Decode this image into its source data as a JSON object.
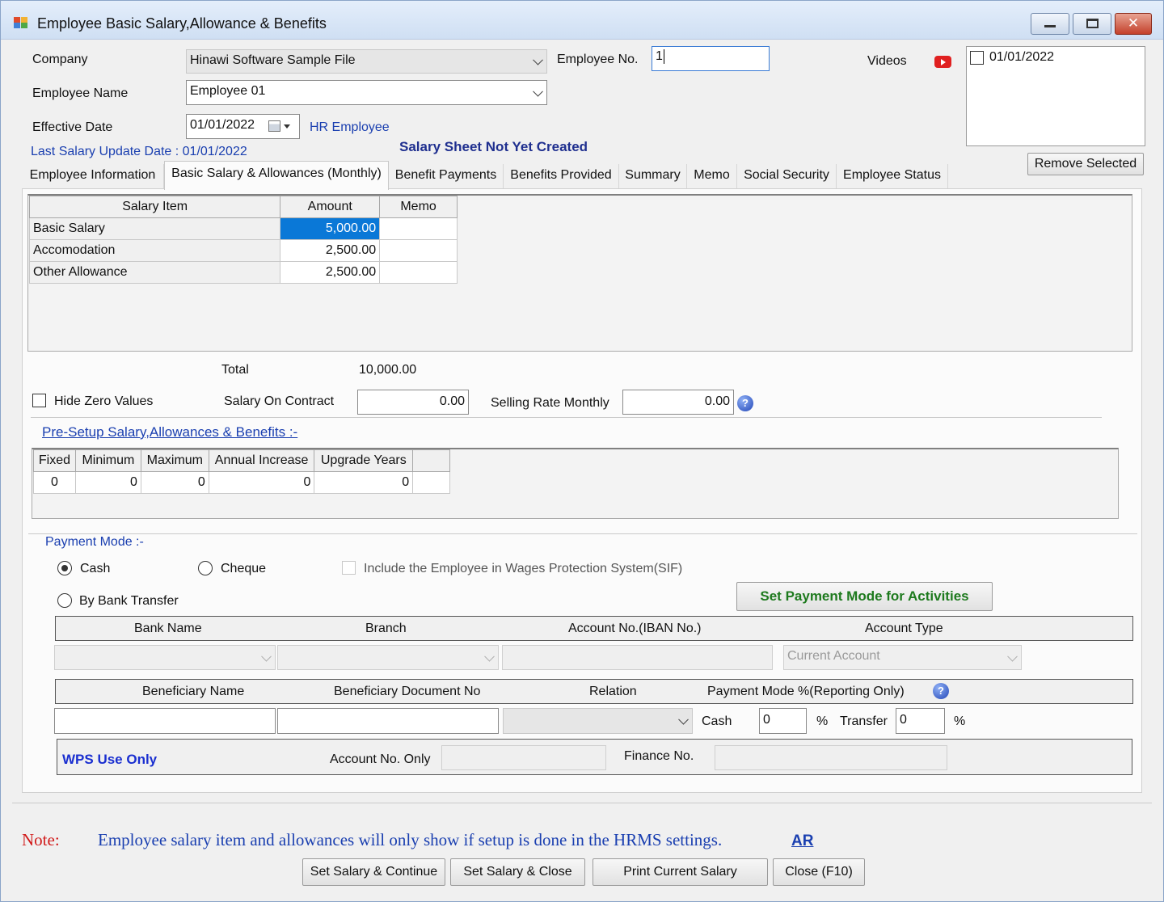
{
  "window": {
    "title": "Employee Basic Salary,Allowance & Benefits"
  },
  "header": {
    "company_label": "Company",
    "company_value": "Hinawi Software Sample File",
    "employee_name_label": "Employee Name",
    "employee_name_value": "Employee 01",
    "effective_date_label": "Effective Date",
    "effective_date_value": "01/01/2022",
    "hr_employee_link": "HR Employee",
    "employee_no_label": "Employee No.",
    "employee_no_value": "1",
    "videos_label": "Videos",
    "last_update": "Last Salary Update Date : 01/01/2022",
    "sheet_status": "Salary Sheet Not Yet Created",
    "date_list": [
      "01/01/2022"
    ],
    "remove_selected_label": "Remove Selected"
  },
  "tabs": [
    {
      "label": "Employee Information"
    },
    {
      "label": "Basic Salary & Allowances (Monthly)"
    },
    {
      "label": "Benefit Payments"
    },
    {
      "label": "Benefits Provided"
    },
    {
      "label": "Summary"
    },
    {
      "label": "Memo"
    },
    {
      "label": "Social Security"
    },
    {
      "label": "Employee Status"
    }
  ],
  "salary_table": {
    "columns": [
      "Salary Item",
      "Amount",
      "Memo"
    ],
    "rows": [
      {
        "item": "Basic Salary",
        "amount": "5,000.00",
        "memo": ""
      },
      {
        "item": "Accomodation",
        "amount": "2,500.00",
        "memo": ""
      },
      {
        "item": "Other Allowance",
        "amount": "2,500.00",
        "memo": ""
      }
    ]
  },
  "totals": {
    "total_label": "Total",
    "total_value": "10,000.00",
    "hide_zero_label": "Hide Zero Values",
    "salary_on_contract_label": "Salary On Contract",
    "salary_on_contract_value": "0.00",
    "selling_rate_label": "Selling Rate Monthly",
    "selling_rate_value": "0.00"
  },
  "presetup": {
    "title": "Pre-Setup Salary,Allowances & Benefits :-",
    "columns": [
      "Fixed",
      "Minimum",
      "Maximum",
      "Annual Increase",
      "Upgrade Years"
    ],
    "values": [
      "0",
      "0",
      "0",
      "0",
      "0"
    ]
  },
  "payment": {
    "title": "Payment Mode :-",
    "cash_label": "Cash",
    "cheque_label": "Cheque",
    "bank_transfer_label": "By Bank Transfer",
    "wps_label": "Include the Employee in Wages Protection System(SIF)",
    "set_mode_button": "Set Payment Mode for Activities",
    "bank_headers": [
      "Bank Name",
      "Branch",
      "Account No.(IBAN No.)",
      "Account Type"
    ],
    "account_type_value": "Current Account",
    "beneficiary_headers": [
      "Beneficiary Name",
      "Beneficiary Document No",
      "Relation",
      "Payment Mode %(Reporting Only)"
    ],
    "cash_pct_label": "Cash",
    "cash_pct_value": "0",
    "pct_sign": "%",
    "transfer_label": "Transfer",
    "transfer_value": "0",
    "wps_use_only": "WPS Use Only",
    "account_no_only_label": "Account No. Only",
    "finance_no_label": "Finance No."
  },
  "footer": {
    "note_label": "Note:",
    "note_text": "Employee salary item and allowances will only show if setup is done in the HRMS settings.",
    "ar_link": "AR",
    "buttons": [
      "Set Salary & Continue",
      "Set Salary & Close",
      "Print Current Salary",
      "Close  (F10)"
    ]
  },
  "colors": {
    "accent_blue": "#1a3fb0",
    "selected_cell": "#0a78d7",
    "note_red": "#d11a1a",
    "green_button_text": "#1e7a1e"
  }
}
